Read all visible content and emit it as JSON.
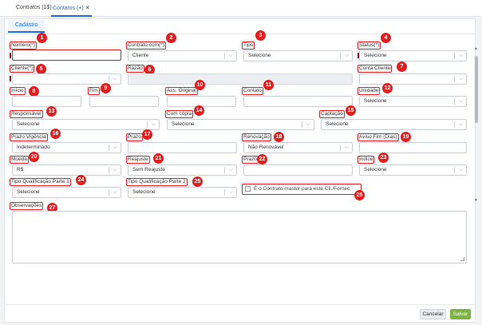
{
  "tabs": [
    {
      "label": "Contratos (1$)"
    },
    {
      "label": "Contatos (+)",
      "close": "✕"
    }
  ],
  "subtab": "Cadastro",
  "fields": {
    "numero": {
      "label": "Número(*)",
      "value": "",
      "badge": "1"
    },
    "contrato_com": {
      "label": "Contrato com(*)",
      "value": "Cliente",
      "badge": "2"
    },
    "tipo": {
      "label": "Tipo",
      "value": "Selecione",
      "badge": "3"
    },
    "status": {
      "label": "Status(*)",
      "value": "Selecione",
      "badge": "4"
    },
    "cliente": {
      "label": "Cliente(*)",
      "value": "",
      "badge": "5"
    },
    "razao": {
      "label": "Razão",
      "value": "",
      "badge": "6"
    },
    "conta_cliente": {
      "label": "Conta Cliente",
      "value": "",
      "badge": "7"
    },
    "inicio": {
      "label": "Início",
      "value": "",
      "badge": "8"
    },
    "fim": {
      "label": "Fim",
      "value": "",
      "badge": "9"
    },
    "ass_original": {
      "label": "Ass. Original",
      "value": "",
      "badge": "10"
    },
    "contato": {
      "label": "Contato",
      "value": "",
      "badge": "11"
    },
    "unidade": {
      "label": "Unidade",
      "value": "Selecione",
      "badge": "12"
    },
    "responsavel": {
      "label": "Responsável",
      "value": "Selecione",
      "badge": "13"
    },
    "com_copia": {
      "label": "Com cópia",
      "value": "Selecione",
      "badge": "14"
    },
    "captacao": {
      "label": "Captação",
      "value": "Selecione",
      "badge": "15"
    },
    "prazo_vigencia": {
      "label": "Prazo Vigência",
      "value": "Indeterminado",
      "badge": "16"
    },
    "prazo": {
      "label": "Prazo",
      "value": "",
      "badge": "17"
    },
    "renovacao": {
      "label": "Renovação",
      "value": "Não Renovável",
      "badge": "18"
    },
    "aviso_fim": {
      "label": "Aviso Fim (Dias)",
      "value": "",
      "badge": "19"
    },
    "moeda": {
      "label": "Moeda",
      "value": "R$",
      "badge": "20"
    },
    "reajuste": {
      "label": "Reajuste",
      "value": "Sem Reajuste",
      "badge": "21"
    },
    "prazo2": {
      "label": "Prazo",
      "value": "",
      "badge": "22"
    },
    "indice": {
      "label": "Índice",
      "value": "Selecione",
      "badge": "23"
    },
    "tipo_qual_1": {
      "label": "Tipo Qualificação Parte 1",
      "value": "Selecione",
      "badge": "24"
    },
    "tipo_qual_2": {
      "label": "Tipo Qualificação Parte 2",
      "value": "Selecione",
      "badge": "25"
    },
    "master": {
      "label": "É o Contrato master para este Cli./Fornec.",
      "badge": "26"
    },
    "observacoes": {
      "label": "Observações",
      "value": "",
      "badge": "27"
    }
  },
  "buttons": {
    "cancel": "Cancelar",
    "save": "Salvar"
  },
  "colors": {
    "accent": "#1e6fd9",
    "annotation": "#e02020",
    "save": "#7cb342"
  }
}
